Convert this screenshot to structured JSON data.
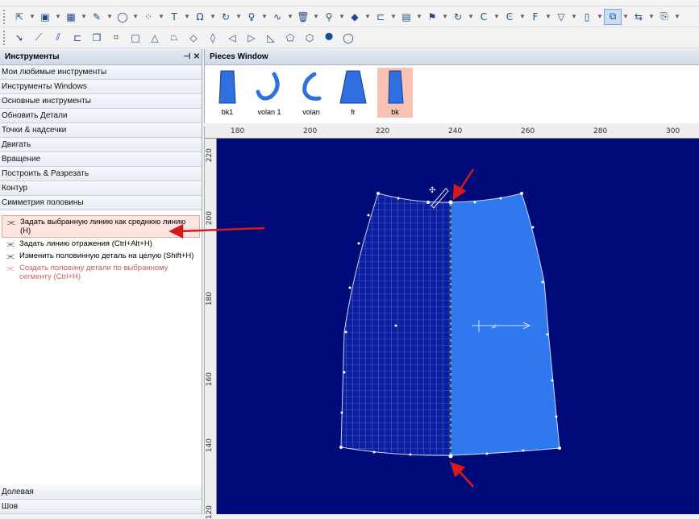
{
  "toolbar_icons_row1": [
    "select-icon",
    "dropdown",
    "piece-icon",
    "dropdown",
    "layout-icon",
    "dropdown",
    "pencil-icon",
    "dropdown",
    "circle-icon",
    "dropdown",
    "scatter-icon",
    "dropdown",
    "text-icon",
    "dropdown",
    "omega-icon",
    "dropdown",
    "rotate-icon",
    "dropdown",
    "curve-icon",
    "dropdown",
    "wave-icon",
    "dropdown",
    "delete-icon",
    "dropdown",
    "pin-icon",
    "dropdown",
    "marker-icon",
    "dropdown",
    "notch-icon",
    "dropdown",
    "grid-icon",
    "dropdown",
    "flag-icon",
    "dropdown",
    "refresh-icon",
    "dropdown",
    "c-icon",
    "dropdown",
    "c2-icon",
    "dropdown",
    "f-icon",
    "dropdown",
    "filter-icon",
    "dropdown",
    "half-icon",
    "dropdown",
    "mirror-icon",
    "dropdown",
    "flip-icon",
    "dropdown",
    "flip2-icon",
    "dropdown"
  ],
  "toolbar_icons_row2": [
    "arrow-icon",
    "knife-icon",
    "seam-icon",
    "notch-icon",
    "copy-icon",
    "measure-icon",
    "square-icon",
    "triangle-icon",
    "trapezoid-icon",
    "diamond-icon",
    "diamond2-icon",
    "triangle2-icon",
    "triangle3-icon",
    "right-triangle-icon",
    "pentagon-icon",
    "hexagon-icon",
    "octagon-icon",
    "circle-icon"
  ],
  "tools_panel": {
    "title": "Инструменты",
    "pin": "⊣",
    "close": "✕",
    "categories": [
      "Мои любимые инструменты",
      "Инструменты Windows",
      "Основные инструменты",
      "Обновить Детали",
      "Точки & надсечки",
      "Двигать",
      "Вращение",
      "Построить & Разрезать",
      "Контур",
      "Симметрия половины"
    ],
    "tools": [
      {
        "label": "Задать выбранную линию как среднюю линию (H)",
        "state": "selected"
      },
      {
        "label": "Задать линию отражения (Ctrl+Alt+H)",
        "state": "normal"
      },
      {
        "label": "Изменить половинную деталь на целую (Shift+H)",
        "state": "normal"
      },
      {
        "label": "Создать половину детали по выбранному сегменту (Ctrl+H)",
        "state": "disabled"
      }
    ],
    "bottom_categories": [
      "Долевая",
      "Шов"
    ]
  },
  "pieces_window": {
    "title": "Pieces Window",
    "pieces": [
      {
        "label": "bk1",
        "selected": false
      },
      {
        "label": "volan 1",
        "selected": false
      },
      {
        "label": "volan",
        "selected": false
      },
      {
        "label": "fr",
        "selected": false
      },
      {
        "label": "bk",
        "selected": true
      }
    ]
  },
  "ruler_h_ticks": [
    "180",
    "200",
    "220",
    "240",
    "260",
    "280",
    "300"
  ],
  "ruler_v_ticks": [
    "220",
    "200",
    "180",
    "160",
    "140",
    "120"
  ],
  "colors": {
    "canvas_bg": "#000a78",
    "piece_fill": "#2f78f0",
    "grid_line": "#8fb0ff",
    "arrow": "#d61a1a",
    "selected_highlight": "#f8c3b5"
  }
}
